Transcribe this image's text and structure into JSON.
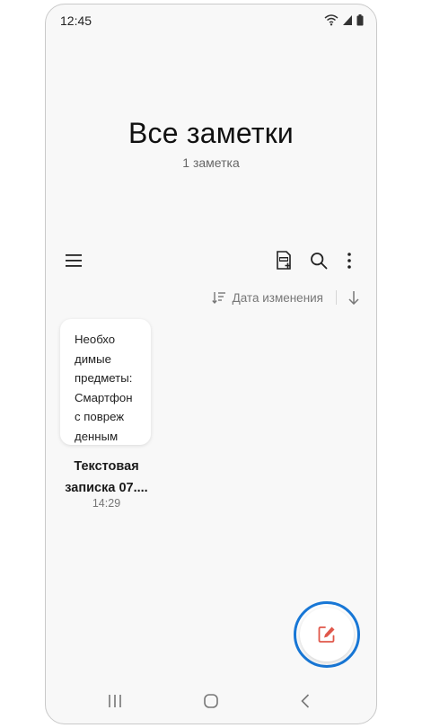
{
  "status_bar": {
    "time": "12:45",
    "icons": [
      "wifi-icon",
      "signal-icon",
      "battery-icon"
    ]
  },
  "header": {
    "title": "Все заметки",
    "subtitle": "1 заметка"
  },
  "toolbar": {
    "left": [
      "menu-icon"
    ],
    "right": [
      "pdf-add-icon",
      "search-icon",
      "more-vert-icon"
    ]
  },
  "sort": {
    "label": "Дата изменения",
    "icons": [
      "sort-icon",
      "arrow-down-icon"
    ]
  },
  "notes": [
    {
      "preview_lines": [
        "Необхо",
        "димые",
        "предметы:",
        "Смартфон",
        "с повреж",
        "денным"
      ],
      "title_lines": [
        "Текстовая",
        "записка 07...."
      ],
      "time": "14:29"
    }
  ],
  "fab": {
    "icon": "compose-icon"
  },
  "nav_bar": {
    "buttons": [
      "recents-icon",
      "home-icon",
      "back-icon"
    ]
  },
  "colors": {
    "background": "#f8f8f8",
    "card": "#ffffff",
    "fab_icon": "#e0574a",
    "highlight_ring": "#1877d6",
    "text_primary": "#111111",
    "text_secondary": "#777777"
  }
}
